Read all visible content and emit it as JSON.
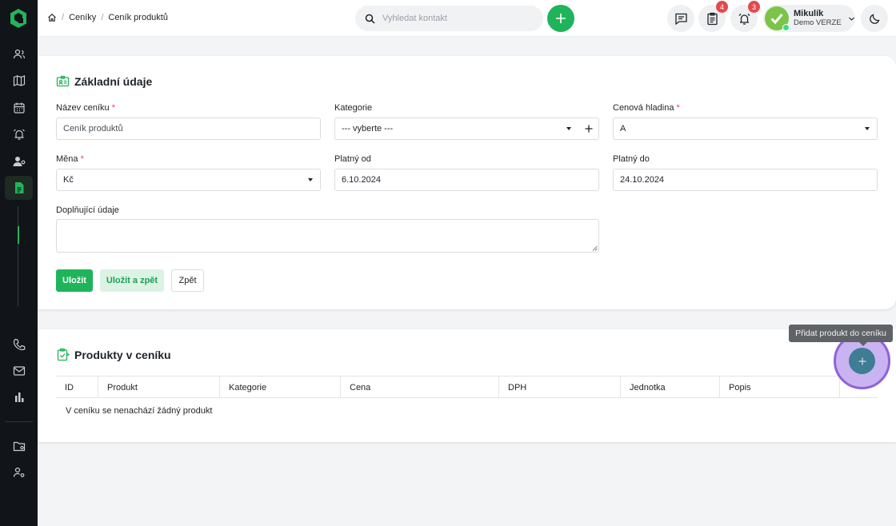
{
  "colors": {
    "accent": "#1fb45a",
    "danger": "#e5484d",
    "sidebar": "#111418",
    "focus_ring": "#8e63d8"
  },
  "breadcrumb": {
    "home_icon": "home-icon",
    "items": [
      "Ceníky",
      "Ceník produktů"
    ]
  },
  "search": {
    "placeholder": "Vyhledat kontakt"
  },
  "header": {
    "notes_badge": "4",
    "alerts_badge": "3",
    "user": {
      "name": "Mikulík",
      "company": "Demo VERZE"
    }
  },
  "basic": {
    "title": "Základní údaje",
    "price_list_name": {
      "label": "Název ceníku",
      "required_mark": "*",
      "value": "Ceník produktů"
    },
    "category": {
      "label": "Kategorie",
      "value": "--- vyberte ---"
    },
    "price_level": {
      "label": "Cenová hladina",
      "required_mark": "*",
      "value": "A"
    },
    "currency": {
      "label": "Měna",
      "required_mark": "*",
      "value": "Kč"
    },
    "valid_from": {
      "label": "Platný od",
      "value": "6.10.2024"
    },
    "valid_to": {
      "label": "Platný do",
      "value": "24.10.2024"
    },
    "notes": {
      "label": "Doplňující údaje",
      "value": ""
    },
    "buttons": {
      "save": "Uložit",
      "save_back": "Uložit a zpět",
      "back": "Zpět"
    }
  },
  "products": {
    "title": "Produkty v ceníku",
    "columns": [
      "ID",
      "Produkt",
      "Kategorie",
      "Cena",
      "DPH",
      "Jednotka",
      "Popis"
    ],
    "empty_message": "V ceníku se nenachází žádný produkt",
    "add_tooltip": "Přidat produkt do ceníku"
  }
}
